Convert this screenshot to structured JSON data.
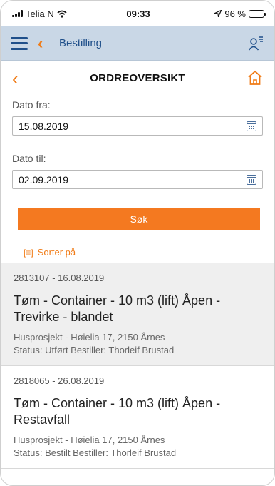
{
  "status_bar": {
    "carrier": "Telia N",
    "time": "09:33",
    "battery": "96 %"
  },
  "app_bar": {
    "title": "Bestilling"
  },
  "page": {
    "title": "ORDREOVERSIKT"
  },
  "form": {
    "date_from_label": "Dato fra:",
    "date_from_value": "15.08.2019",
    "date_to_label": "Dato til:",
    "date_to_value": "02.09.2019",
    "search_label": "Søk",
    "sort_label": "Sorter på"
  },
  "orders": [
    {
      "meta": "2813107 - 16.08.2019",
      "title": "Tøm - Container - 10 m3 (lift) Åpen - Trevirke - blandet",
      "address": "Husprosjekt - Høielia 17, 2150 Årnes",
      "status": "Status: Utført Bestiller: Thorleif Brustad"
    },
    {
      "meta": "2818065 - 26.08.2019",
      "title": "Tøm - Container - 10 m3 (lift) Åpen - Restavfall",
      "address": "Husprosjekt - Høielia 17, 2150 Årnes",
      "status": "Status: Bestilt Bestiller: Thorleif Brustad"
    }
  ],
  "colors": {
    "accent": "#f47920",
    "appbar_bg": "#c9d7e6",
    "nav_blue": "#1f4f8a"
  }
}
